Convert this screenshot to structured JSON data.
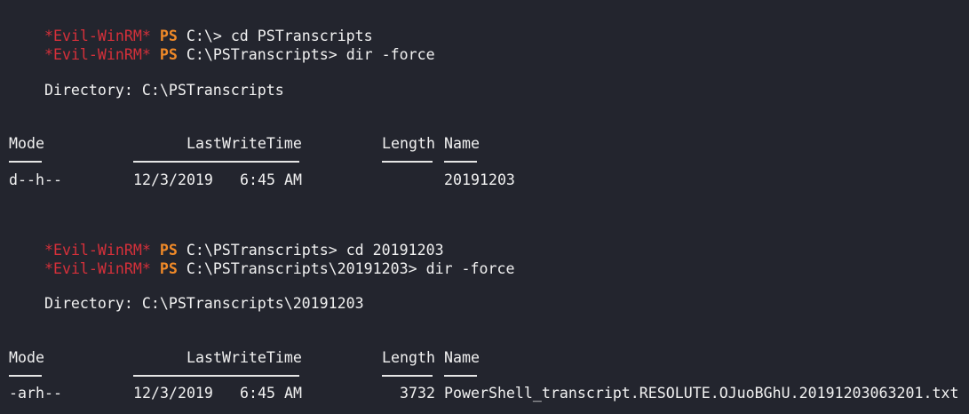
{
  "colors": {
    "background": "#23252e",
    "foreground": "#f1f1f1",
    "evil_winrm": "#d5303a",
    "ps": "#f18a28"
  },
  "prompt": {
    "evil": "*Evil-WinRM*",
    "ps": "PS"
  },
  "commands": [
    {
      "path": "C:\\>",
      "cmd": "cd PSTranscripts"
    },
    {
      "path": "C:\\PSTranscripts>",
      "cmd": "dir -force"
    },
    {
      "path": "C:\\PSTranscripts>",
      "cmd": "cd 20191203"
    },
    {
      "path": "C:\\PSTranscripts\\20191203>",
      "cmd": "dir -force"
    }
  ],
  "listings": [
    {
      "directory": "    Directory: C:\\PSTranscripts",
      "headers": {
        "mode": "Mode",
        "lastwrite": "LastWriteTime",
        "length": "Length",
        "name": "Name"
      },
      "rows": [
        {
          "mode": "d--h--",
          "date": "12/3/2019",
          "time": "6:45 AM",
          "length": "",
          "name": "20191203"
        }
      ]
    },
    {
      "directory": "    Directory: C:\\PSTranscripts\\20191203",
      "headers": {
        "mode": "Mode",
        "lastwrite": "LastWriteTime",
        "length": "Length",
        "name": "Name"
      },
      "rows": [
        {
          "mode": "-arh--",
          "date": "12/3/2019",
          "time": "6:45 AM",
          "length": "3732",
          "name": "PowerShell_transcript.RESOLUTE.OJuoBGhU.20191203063201.txt"
        }
      ]
    }
  ]
}
